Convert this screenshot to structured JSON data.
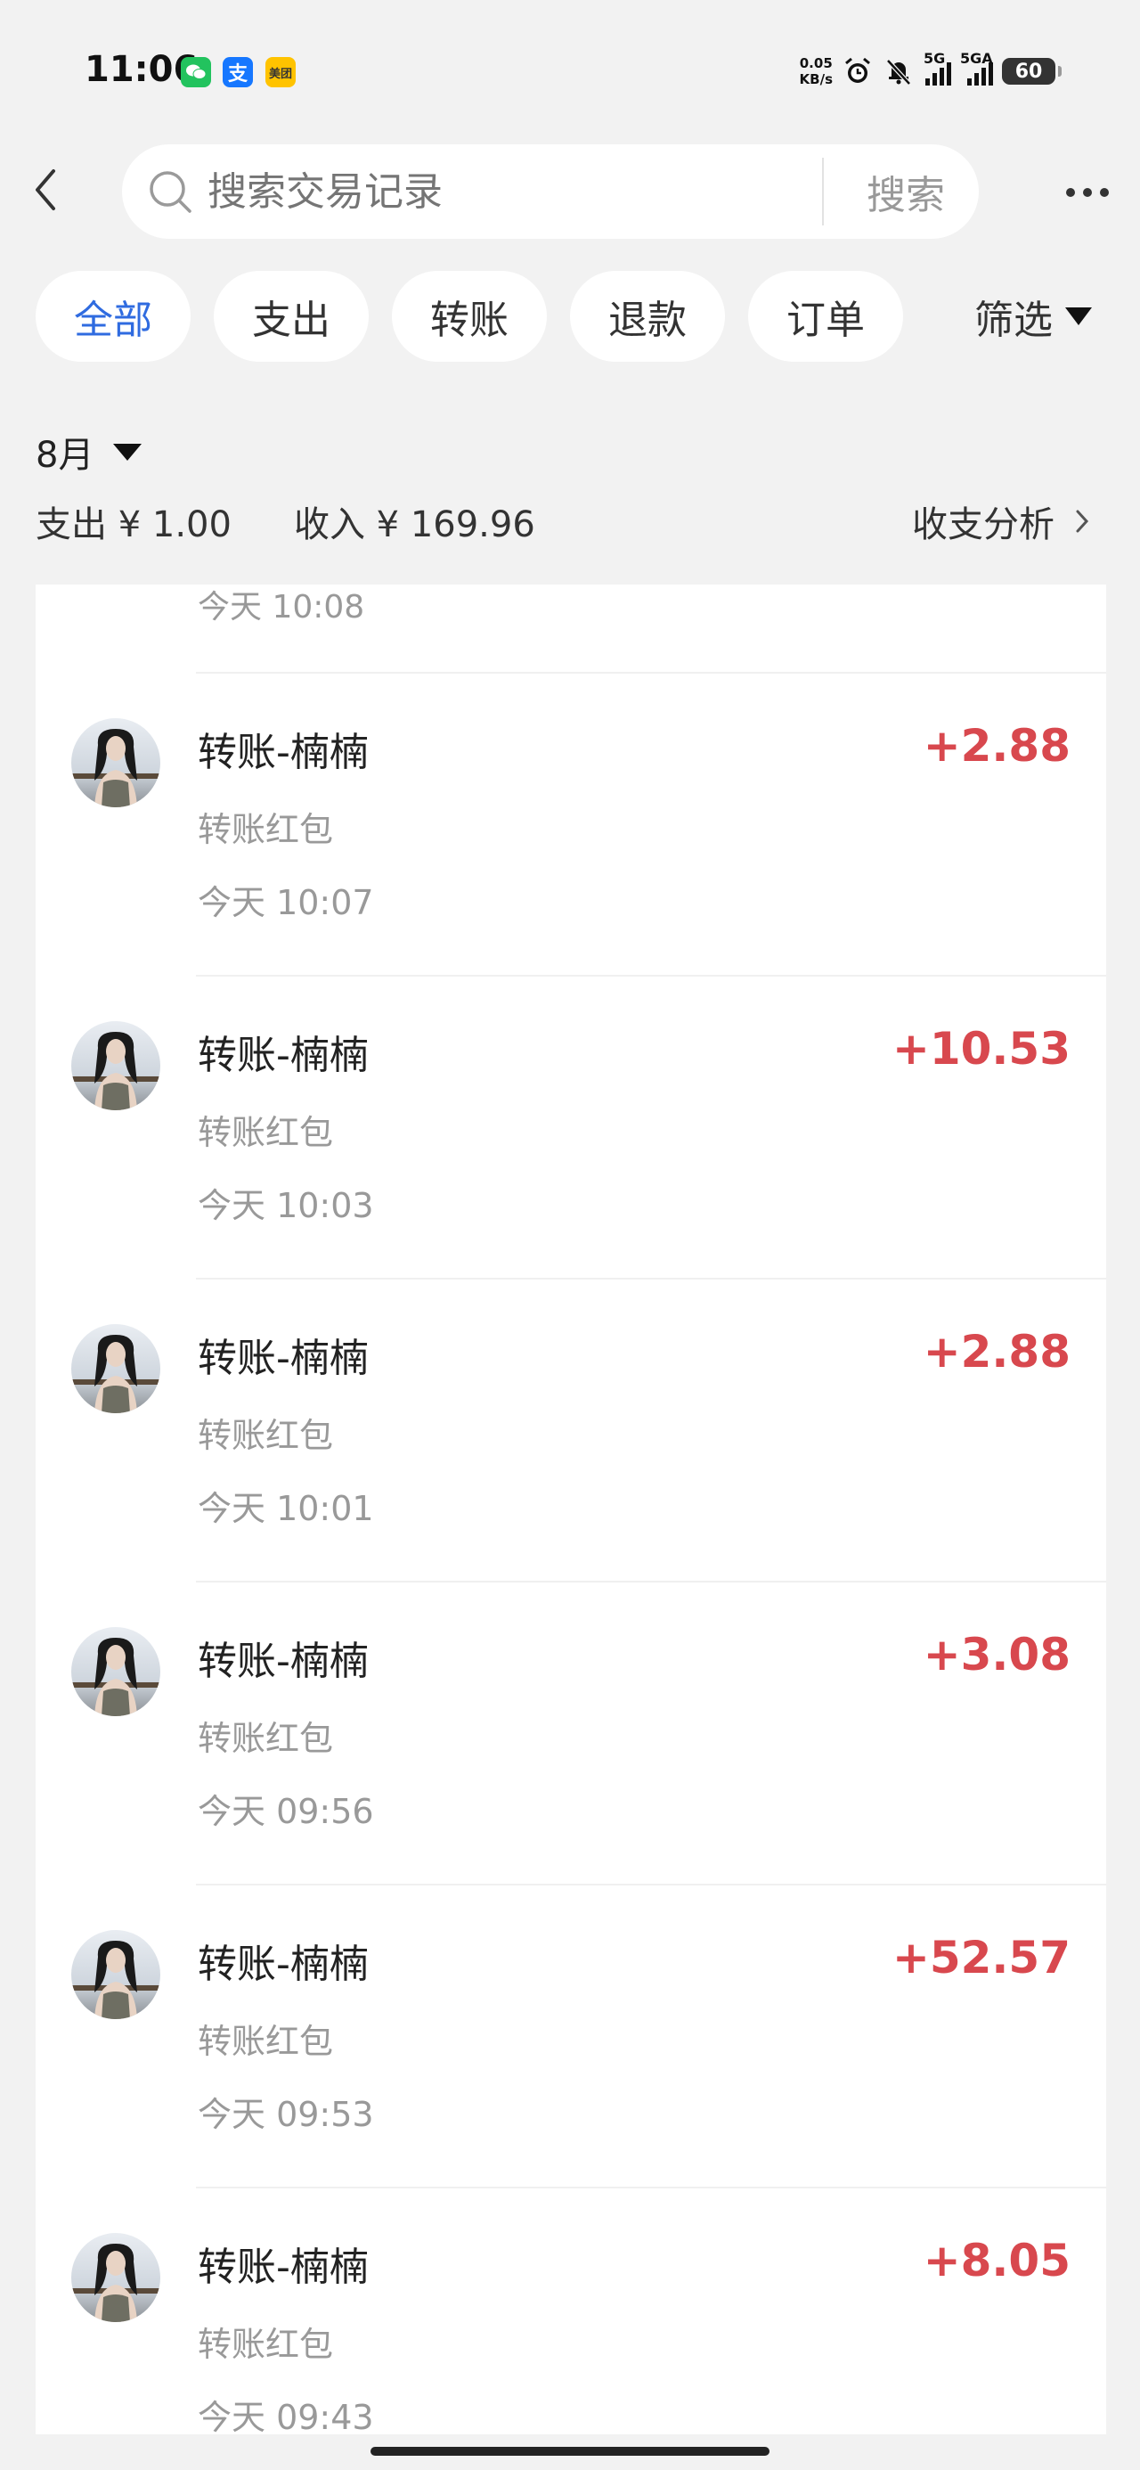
{
  "status_bar": {
    "time": "11:06",
    "apps": [
      "wechat-icon",
      "alipay-icon",
      "meituan-icon"
    ],
    "alipay_glyph": "支",
    "meituan_text": "美团",
    "net_speed": "0.05",
    "net_unit": "KB/s",
    "signal1_label": "5G",
    "signal2_label": "5GA",
    "battery": "60"
  },
  "search": {
    "placeholder": "搜索交易记录",
    "button_label": "搜索"
  },
  "filters": {
    "chips": [
      "全部",
      "支出",
      "转账",
      "退款",
      "订单"
    ],
    "active_index": 0,
    "active_color": "#2f6be0",
    "filter_label": "筛选"
  },
  "summary": {
    "month": "8月",
    "expense": "支出 ¥ 1.00",
    "income": "收入 ¥ 169.96",
    "analysis_label": "收支分析"
  },
  "list": {
    "partial_top_time": "今天 10:08",
    "amount_color": "#d8484e",
    "transactions": [
      {
        "title": "转账-楠楠",
        "subtitle": "转账红包",
        "time": "今天 10:07",
        "amount": "+2.88"
      },
      {
        "title": "转账-楠楠",
        "subtitle": "转账红包",
        "time": "今天 10:03",
        "amount": "+10.53"
      },
      {
        "title": "转账-楠楠",
        "subtitle": "转账红包",
        "time": "今天 10:01",
        "amount": "+2.88"
      },
      {
        "title": "转账-楠楠",
        "subtitle": "转账红包",
        "time": "今天 09:56",
        "amount": "+3.08"
      },
      {
        "title": "转账-楠楠",
        "subtitle": "转账红包",
        "time": "今天 09:53",
        "amount": "+52.57"
      },
      {
        "title": "转账-楠楠",
        "subtitle": "转账红包",
        "time": "今天 09:43",
        "amount": "+8.05"
      }
    ]
  }
}
